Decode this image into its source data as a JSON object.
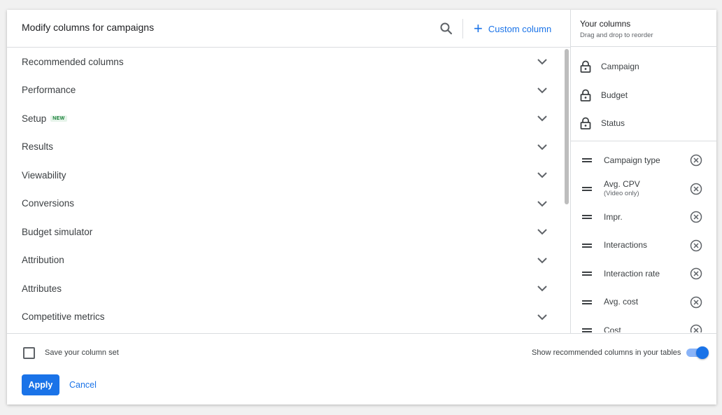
{
  "dialog": {
    "title": "Modify columns for campaigns",
    "search_icon": "search-icon",
    "custom_column_label": "Custom column"
  },
  "sections": [
    {
      "label": "Recommended columns",
      "badge": ""
    },
    {
      "label": "Performance",
      "badge": ""
    },
    {
      "label": "Setup",
      "badge": "NEW"
    },
    {
      "label": "Results",
      "badge": ""
    },
    {
      "label": "Viewability",
      "badge": ""
    },
    {
      "label": "Conversions",
      "badge": ""
    },
    {
      "label": "Budget simulator",
      "badge": ""
    },
    {
      "label": "Attribution",
      "badge": ""
    },
    {
      "label": "Attributes",
      "badge": ""
    },
    {
      "label": "Competitive metrics",
      "badge": ""
    }
  ],
  "your_columns": {
    "title": "Your columns",
    "subtitle": "Drag and drop to reorder",
    "locked": [
      "Campaign",
      "Budget",
      "Status"
    ],
    "movable": [
      {
        "label": "Campaign type",
        "sub": ""
      },
      {
        "label": "Avg. CPV",
        "sub": "(Video only)"
      },
      {
        "label": "Impr.",
        "sub": ""
      },
      {
        "label": "Interactions",
        "sub": ""
      },
      {
        "label": "Interaction rate",
        "sub": ""
      },
      {
        "label": "Avg. cost",
        "sub": ""
      },
      {
        "label": "Cost",
        "sub": ""
      }
    ]
  },
  "footer": {
    "save_label": "Save your column set",
    "save_checked": false,
    "toggle_label": "Show recommended columns in your tables",
    "toggle_on": true,
    "apply_label": "Apply",
    "cancel_label": "Cancel"
  },
  "colors": {
    "accent": "#1a73e8",
    "new_badge": "#188038"
  }
}
